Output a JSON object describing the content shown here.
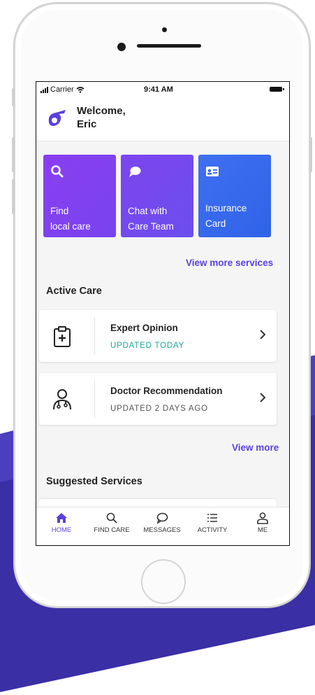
{
  "status_bar": {
    "carrier": "Carrier",
    "time": "9:41 AM"
  },
  "header": {
    "welcome": "Welcome,",
    "user_name": "Eric"
  },
  "services": [
    {
      "line1": "Find",
      "line2": "local care",
      "icon": "search-icon"
    },
    {
      "line1": "Chat with",
      "line2": "Care Team",
      "icon": "chat-bubble-icon"
    },
    {
      "line1": "Insurance",
      "line2": "Card",
      "icon": "id-card-icon"
    }
  ],
  "view_more_services": "View more services",
  "active_care": {
    "title": "Active Care",
    "items": [
      {
        "title": "Expert Opinion",
        "status": "UPDATED TODAY",
        "status_color": "#1aa89b",
        "icon": "medical-clipboard-icon"
      },
      {
        "title": "Doctor Recommendation",
        "status": "UPDATED 2 DAYS AGO",
        "status_color": "#555555",
        "icon": "doctor-icon"
      }
    ],
    "view_more": "View more"
  },
  "suggested_services": {
    "title": "Suggested Services"
  },
  "tabs": [
    {
      "label": "HOME",
      "icon": "home-icon",
      "active": true
    },
    {
      "label": "FIND CARE",
      "icon": "search-icon",
      "active": false
    },
    {
      "label": "MESSAGES",
      "icon": "chat-bubble-icon",
      "active": false
    },
    {
      "label": "ACTIVITY",
      "icon": "list-icon",
      "active": false
    },
    {
      "label": "ME",
      "icon": "person-icon",
      "active": false
    }
  ],
  "colors": {
    "accent": "#5a3fe0",
    "updated_today": "#1aa89b"
  }
}
